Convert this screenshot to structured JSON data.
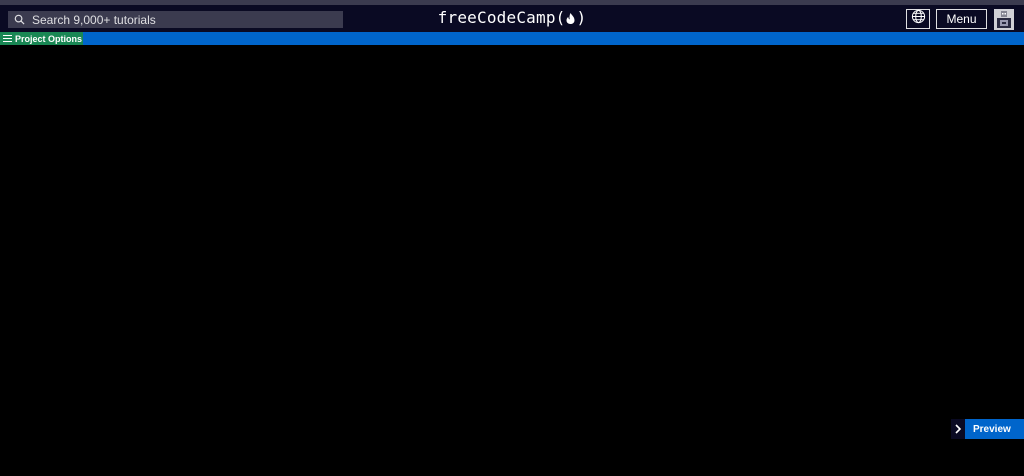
{
  "navbar": {
    "search": {
      "placeholder": "Search 9,000+ tutorials"
    },
    "logo": {
      "text": "freeCodeCamp(",
      "suffix": ")"
    },
    "globe_icon": "globe-icon",
    "menu_label": "Menu",
    "avatar_icon": "user-avatar"
  },
  "toolbar": {
    "project_options_label": "Project Options",
    "project_options_icon": "hamburger-icon"
  },
  "preview": {
    "label": "Preview",
    "icon": "chevron-right-icon"
  },
  "colors": {
    "navbar_bg": "#0a0a23",
    "search_bg": "#3b3b4f",
    "options_bar": "#0065cb",
    "project_options_bg": "#198754",
    "workspace_bg": "#000000"
  }
}
